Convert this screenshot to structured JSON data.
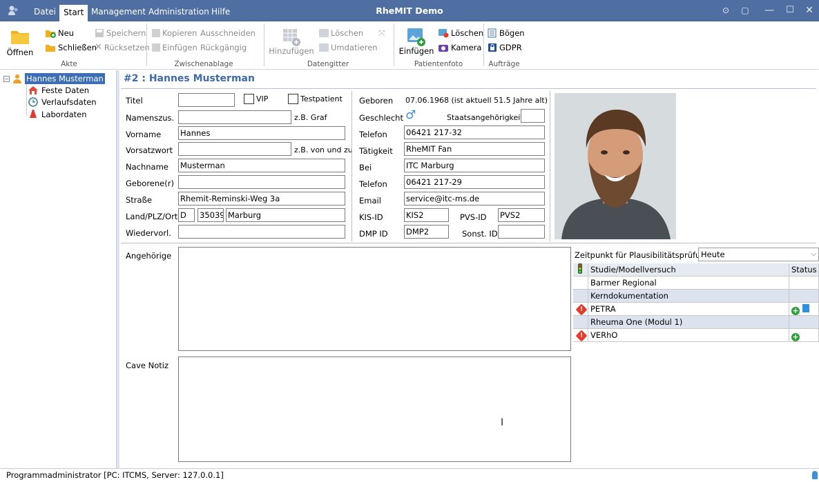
{
  "titlebar": {
    "app_title": "RheMIT Demo",
    "menu": [
      "Datei",
      "Start",
      "Management",
      "Administration",
      "Hilfe"
    ],
    "active_menu": "Start"
  },
  "ribbon": {
    "akte": {
      "open": "Öffnen",
      "new": "Neu",
      "close": "Schließen",
      "save": "Speichern",
      "reset": "Rücksetzen",
      "label": "Akte"
    },
    "clipboard": {
      "copy": "Kopieren",
      "cut": "Ausschneiden",
      "paste": "Einfügen",
      "undo": "Rückgängig",
      "label": "Zwischenablage"
    },
    "datagrid": {
      "add": "Hinzufügen",
      "delete": "Löschen",
      "redate": "Umdatieren",
      "label": "Datengitter"
    },
    "photo": {
      "insert": "Einfügen",
      "delete": "Löschen",
      "camera": "Kamera",
      "label": "Patientenfoto"
    },
    "orders": {
      "sheets": "Bögen",
      "gdpr": "GDPR",
      "label": "Aufträge"
    }
  },
  "tree": {
    "root": "Hannes Musterman",
    "children": [
      "Feste Daten",
      "Verlaufsdaten",
      "Labordaten"
    ]
  },
  "header": {
    "title": "#2 : Hannes Musterman"
  },
  "form": {
    "labels": {
      "titel": "Titel",
      "namenszus": "Namenszus.",
      "vorname": "Vorname",
      "vorsatzwort": "Vorsatzwort",
      "nachname": "Nachname",
      "geborene": "Geborene(r)",
      "strasse": "Straße",
      "land_plz_ort": "Land/PLZ/Ort",
      "wiedervorl": "Wiedervorl.",
      "vip": "VIP",
      "testpatient": "Testpatient",
      "hint_graf": "z.B. Graf",
      "hint_vonundzu": "z.B. von und zu",
      "geboren": "Geboren",
      "geschlecht": "Geschlecht",
      "staatsangehoerigkeit": "Staatsangehörigkeit",
      "telefon": "Telefon",
      "taetigkeit": "Tätigkeit",
      "bei": "Bei",
      "telefon2": "Telefon",
      "email": "Email",
      "kis_id": "KIS-ID",
      "pvs_id": "PVS-ID",
      "dmp_id": "DMP ID",
      "sonst_id": "Sonst. ID",
      "angehoerige": "Angehörige",
      "cave_notiz": "Cave Notiz"
    },
    "values": {
      "titel": "",
      "namenszus": "",
      "vorname": "Hannes",
      "vorsatzwort": "",
      "nachname": "Musterman",
      "geborene": "",
      "strasse": "Rhemit-Reminski-Weg 3a",
      "land": "D",
      "plz": "35039",
      "ort": "Marburg",
      "wiedervorl": "",
      "geboren": "07.06.1968 (ist aktuell 51.5 Jahre alt)",
      "geschlecht_symbol": "♂",
      "staatsangehoerigkeit": "",
      "telefon": "06421 217-32",
      "taetigkeit": "RheMIT Fan",
      "bei": "ITC Marburg",
      "telefon2": "06421 217-29",
      "email": "service@itc-ms.de",
      "kis_id": "KIS2",
      "pvs_id": "PVS2",
      "dmp_id": "DMP2",
      "sonst_id": ""
    }
  },
  "plausibility": {
    "label": "Zeitpunkt für Plausibilitätsprüfung",
    "value": "Heute",
    "headers": {
      "name": "Studie/Modellversuch",
      "status": "Status"
    },
    "rows": [
      {
        "name": "Barmer Regional",
        "group": false,
        "warn": false,
        "plus": false,
        "doc": false
      },
      {
        "name": "Kerndokumentation",
        "group": true,
        "warn": false,
        "plus": false,
        "doc": false
      },
      {
        "name": "PETRA",
        "group": false,
        "warn": true,
        "plus": true,
        "doc": true
      },
      {
        "name": "Rheuma One (Modul 1)",
        "group": true,
        "warn": false,
        "plus": false,
        "doc": false
      },
      {
        "name": "VERhO",
        "group": false,
        "warn": true,
        "plus": true,
        "doc": false
      }
    ]
  },
  "statusbar": {
    "text": "Programmadministrator [PC: ITCMS, Server: 127.0.0.1]"
  },
  "colors": {
    "titlebar": "#4f6fa3",
    "header_text": "#3f6aa8",
    "selected": "#3d6eb4"
  }
}
